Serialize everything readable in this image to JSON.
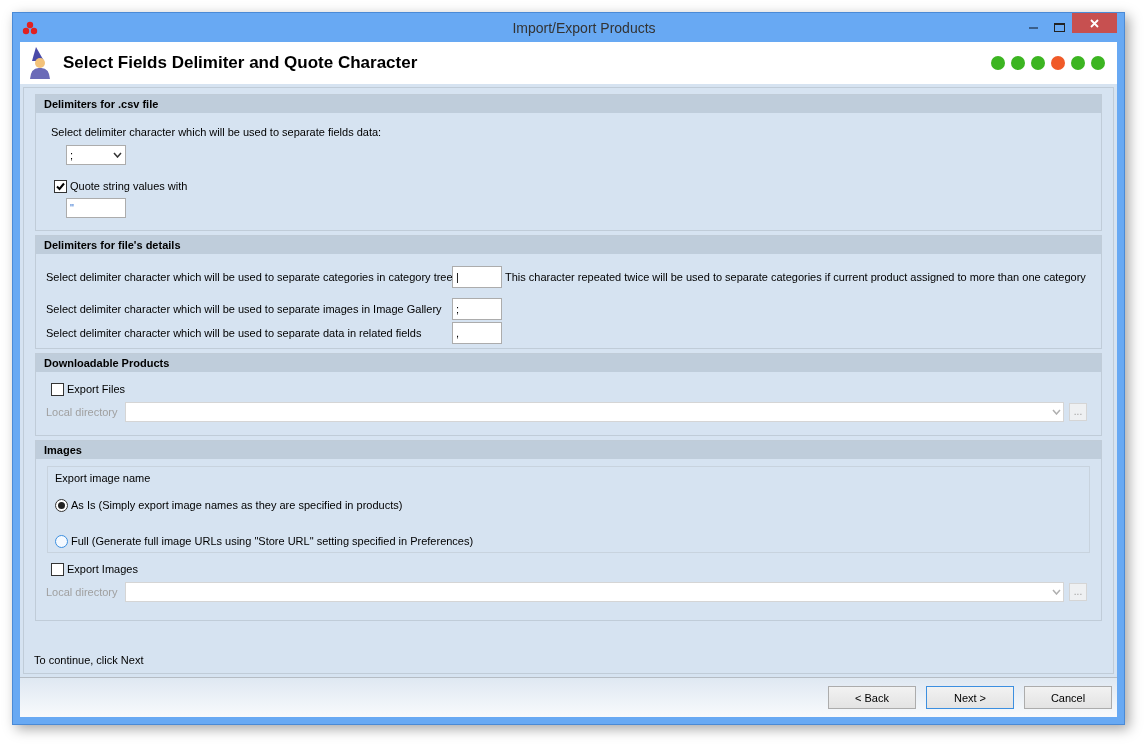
{
  "window": {
    "title": "Import/Export Products"
  },
  "header": {
    "title": "Select Fields Delimiter and Quote Character",
    "steps": [
      {
        "color": "#3cb521"
      },
      {
        "color": "#3cb521"
      },
      {
        "color": "#3cb521"
      },
      {
        "color": "#f05a28"
      },
      {
        "color": "#3cb521"
      },
      {
        "color": "#3cb521"
      }
    ]
  },
  "csv_section": {
    "title": "Delimiters for .csv file",
    "delimiter_prompt": "Select delimiter character which will be used to separate fields data:",
    "delimiter": {
      "value": ";"
    },
    "quote": {
      "label": "Quote string values with",
      "checked": true,
      "value": "\""
    }
  },
  "details_section": {
    "title": "Delimiters for file's details",
    "rows": [
      {
        "label": "Select delimiter character which will be used to separate categories in category tree",
        "value": "|",
        "note": "This character repeated twice will be used to separate categories if current product assigned to more than one category"
      },
      {
        "label": "Select delimiter character which will be used to separate images in Image Gallery",
        "value": ";"
      },
      {
        "label": "Select delimiter character which will be used to separate data in related fields",
        "value": ","
      }
    ]
  },
  "downloadable_section": {
    "title": "Downloadable Products",
    "export": {
      "label": "Export Files",
      "checked": false
    },
    "directory": {
      "label": "Local directory",
      "disabled": true,
      "browse": "..."
    }
  },
  "images_section": {
    "title": "Images",
    "name_group": {
      "title": "Export image name",
      "options": [
        {
          "label": "As Is (Simply export image names as they are specified in products)",
          "selected": true
        },
        {
          "label": "Full (Generate full image URLs using \"Store URL\" setting specified in Preferences)",
          "selected": false
        }
      ]
    },
    "export": {
      "label": "Export Images",
      "checked": false
    },
    "directory": {
      "label": "Local directory",
      "disabled": true,
      "browse": "..."
    }
  },
  "hint": "To continue, click Next",
  "buttons": [
    {
      "label": "< Back",
      "default": false
    },
    {
      "label": "Next >",
      "default": true
    },
    {
      "label": "Cancel",
      "default": false
    }
  ]
}
